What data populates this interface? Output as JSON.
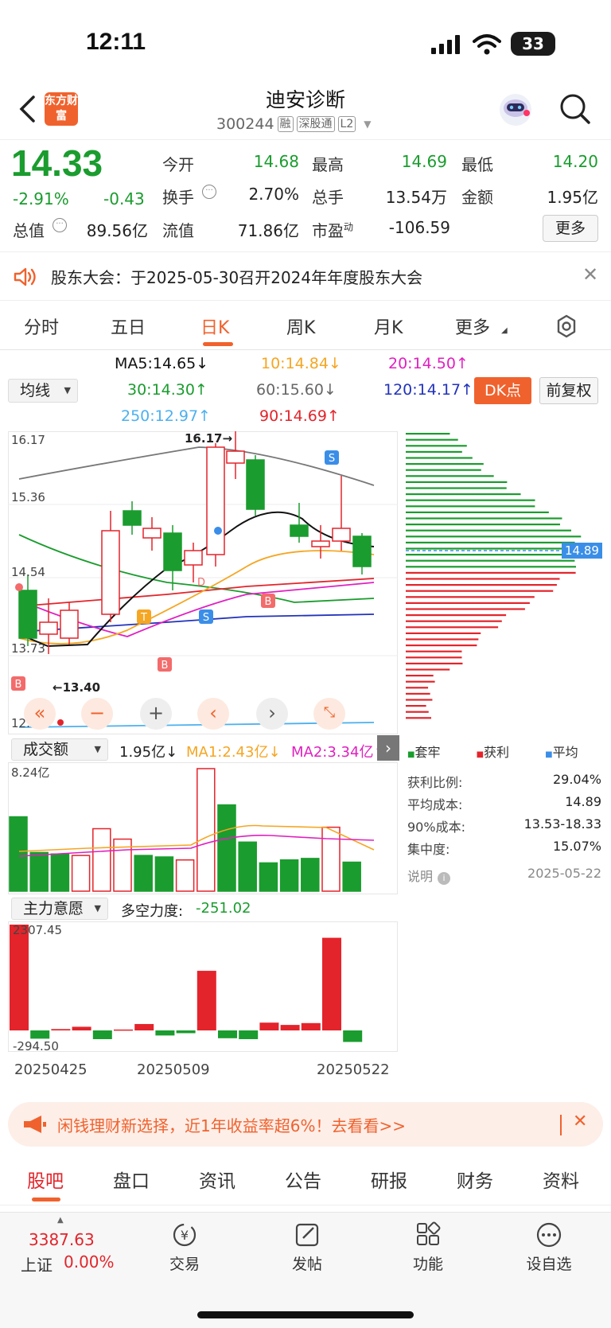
{
  "status": {
    "time": "12:11",
    "battery": "33"
  },
  "nav": {
    "logo": "东方财富",
    "title": "迪安诊断",
    "code": "300244",
    "tags": [
      "融",
      "深股通",
      "L2"
    ]
  },
  "quote": {
    "price": "14.33",
    "change_pct": "-2.91%",
    "change": "-0.43",
    "cells": [
      {
        "label": "今开",
        "value": "14.68",
        "color": "green"
      },
      {
        "label": "最高",
        "value": "14.69",
        "color": "green"
      },
      {
        "label": "最低",
        "value": "14.20",
        "color": "green"
      },
      {
        "label": "换手",
        "value": "2.70%",
        "color": "black"
      },
      {
        "label": "总手",
        "value": "13.54万",
        "color": "black"
      },
      {
        "label": "金额",
        "value": "1.95亿",
        "color": "black"
      },
      {
        "label": "总值",
        "value": "89.56亿",
        "color": "black"
      },
      {
        "label": "流值",
        "value": "71.86亿",
        "color": "black"
      },
      {
        "label": "市盈",
        "value": "-106.59",
        "color": "black",
        "sup": "动"
      }
    ],
    "more_label": "更多"
  },
  "notice": {
    "text": "股东大会：于2025-05-30召开2024年年度股东大会"
  },
  "tabs": [
    "分时",
    "五日",
    "日K",
    "周K",
    "月K",
    "更多"
  ],
  "active_tab": "日K",
  "ma": {
    "selector": "均线",
    "items": [
      {
        "text": "MA5:14.65↓",
        "color": "#111111"
      },
      {
        "text": "10:14.84↓",
        "color": "#f5a623"
      },
      {
        "text": "20:14.50↑",
        "color": "#e020c0"
      },
      {
        "text": "30:14.30↑",
        "color": "#1a9c2e"
      },
      {
        "text": "60:15.60↓",
        "color": "#666666"
      },
      {
        "text": "120:14.17↑",
        "color": "#2233bb"
      },
      {
        "text": "250:12.97↑",
        "color": "#4db0ee"
      },
      {
        "text": "90:14.69↑",
        "color": "#e3242b"
      }
    ],
    "dk_label": "DK点",
    "fq_label": "前复权"
  },
  "kline": {
    "price_labels": [
      "16.17",
      "15.36",
      "14.54",
      "13.73",
      "12.92"
    ],
    "high_note": "16.17→",
    "low_note": "←13.40",
    "cost_price": "14.89",
    "markers": [
      "B",
      "T",
      "D",
      "B",
      "S",
      "S",
      "B"
    ]
  },
  "chips": {
    "legend": [
      "套牢",
      "获利",
      "平均"
    ],
    "stats": [
      {
        "label": "获利比例:",
        "value": "29.04%"
      },
      {
        "label": "平均成本:",
        "value": "14.89"
      },
      {
        "label": "90%成本:",
        "value": "13.53-18.33"
      },
      {
        "label": "集中度:",
        "value": "15.07%"
      },
      {
        "label": "说明",
        "value": "2025-05-22"
      }
    ]
  },
  "volume": {
    "selector": "成交额",
    "value": "1.95亿↓",
    "ma1": "MA1:2.43亿↓",
    "ma2": "MA2:3.34亿↑",
    "max_label": "8.24亿",
    "bars": [
      {
        "v": 5.0,
        "up": false
      },
      {
        "v": 2.6,
        "up": false
      },
      {
        "v": 2.5,
        "up": false
      },
      {
        "v": 2.4,
        "up": true
      },
      {
        "v": 4.2,
        "up": true
      },
      {
        "v": 3.5,
        "up": true
      },
      {
        "v": 2.4,
        "up": false
      },
      {
        "v": 2.3,
        "up": false
      },
      {
        "v": 2.1,
        "up": true
      },
      {
        "v": 8.24,
        "up": true
      },
      {
        "v": 5.8,
        "up": false
      },
      {
        "v": 3.3,
        "up": false
      },
      {
        "v": 1.9,
        "up": false
      },
      {
        "v": 2.1,
        "up": false
      },
      {
        "v": 2.2,
        "up": false
      },
      {
        "v": 4.3,
        "up": true
      },
      {
        "v": 1.95,
        "up": false
      }
    ]
  },
  "force": {
    "selector": "主力意愿",
    "label": "多空力度:",
    "value": "-251.02",
    "max_label": "2307.45",
    "min_label": "-294.50",
    "bars": [
      2307,
      -180,
      30,
      80,
      -190,
      20,
      140,
      -110,
      -60,
      1300,
      -170,
      -190,
      170,
      120,
      160,
      2020,
      -251
    ],
    "dates": [
      "20250425",
      "20250509",
      "20250522"
    ]
  },
  "banner": {
    "text": "闲钱理财新选择，近1年收益率超6%！去看看>>"
  },
  "bottom_tabs": [
    "股吧",
    "盘口",
    "资讯",
    "公告",
    "研报",
    "财务",
    "资料"
  ],
  "toolbar": {
    "index_value": "3387.63",
    "index_name": "上证",
    "index_change": "0.00%",
    "items": [
      "交易",
      "发帖",
      "功能",
      "设自选"
    ]
  }
}
